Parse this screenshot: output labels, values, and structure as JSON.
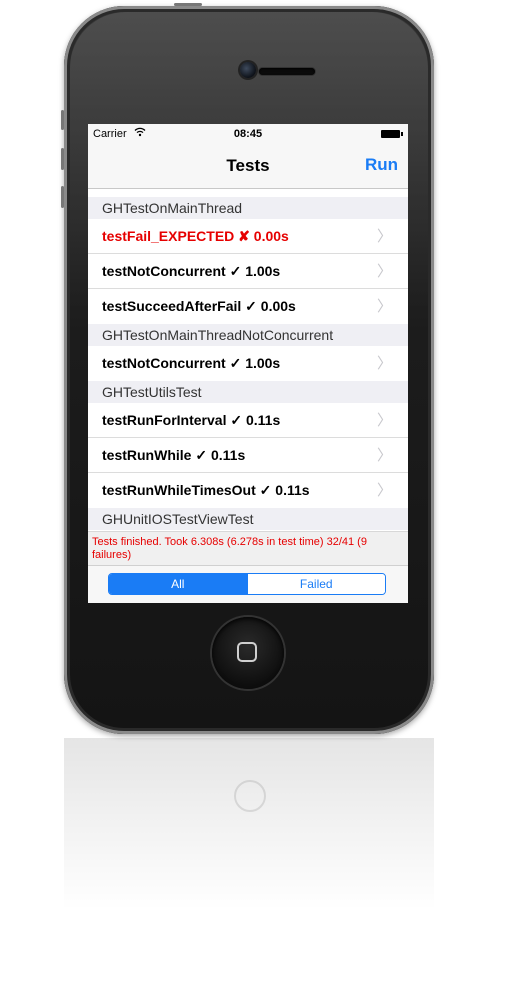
{
  "status_bar": {
    "carrier": "Carrier",
    "wifi_icon": "wifi-icon",
    "time": "08:45",
    "battery_icon": "battery-icon"
  },
  "nav": {
    "title": "Tests",
    "run_button": "Run"
  },
  "sections": [
    {
      "title": "GHTestOnMainThread",
      "rows": [
        {
          "name": "testFail_EXPECTED",
          "mark": "✘",
          "time": "0.00s",
          "status": "failed"
        },
        {
          "name": "testNotConcurrent",
          "mark": "✓",
          "time": "1.00s",
          "status": "passed"
        },
        {
          "name": "testSucceedAfterFail",
          "mark": "✓",
          "time": "0.00s",
          "status": "passed"
        }
      ]
    },
    {
      "title": "GHTestOnMainThreadNotConcurrent",
      "rows": [
        {
          "name": "testNotConcurrent",
          "mark": "✓",
          "time": "1.00s",
          "status": "passed"
        }
      ]
    },
    {
      "title": "GHTestUtilsTest",
      "rows": [
        {
          "name": "testRunForInterval",
          "mark": "✓",
          "time": "0.11s",
          "status": "passed"
        },
        {
          "name": "testRunWhile",
          "mark": "✓",
          "time": "0.11s",
          "status": "passed"
        },
        {
          "name": "testRunWhileTimesOut",
          "mark": "✓",
          "time": "0.11s",
          "status": "passed"
        }
      ]
    },
    {
      "title": "GHUnitIOSTestViewTest",
      "rows": []
    }
  ],
  "footer": {
    "status_text": "Tests finished. Took 6.308s (6.278s in test time) 32/41 (9 failures)"
  },
  "filter": {
    "options": [
      "All",
      "Failed"
    ],
    "selected": "All"
  },
  "colors": {
    "accent": "#1a7cf5",
    "fail": "#e60000"
  }
}
